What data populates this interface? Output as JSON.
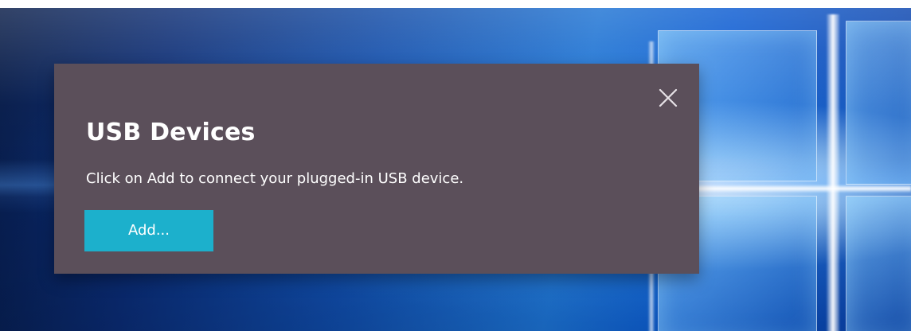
{
  "dialog": {
    "title": "USB Devices",
    "description": "Click on Add to connect your plugged-in USB device.",
    "add_button_label": "Add...",
    "close_icon": "close-icon"
  },
  "colors": {
    "dialog_background": "#5b4f5a",
    "add_button": "#1cb0cc",
    "text": "#ffffff"
  }
}
